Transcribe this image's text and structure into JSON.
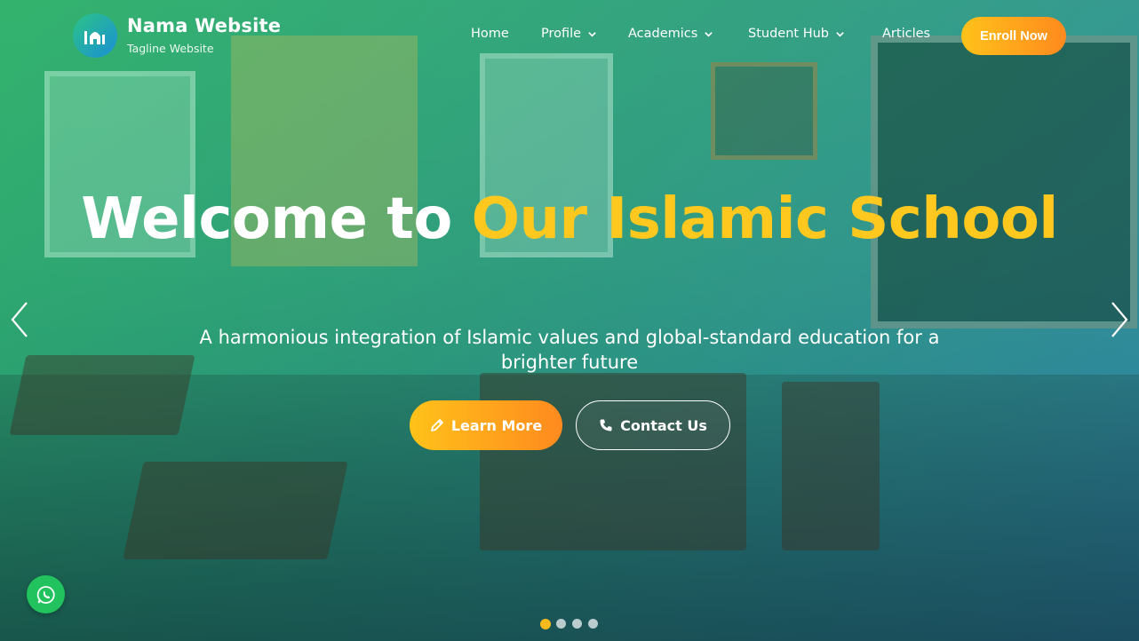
{
  "brand": {
    "name": "Nama Website",
    "tagline": "Tagline Website"
  },
  "nav": {
    "items": [
      {
        "label": "Home",
        "dropdown": false
      },
      {
        "label": "Profile",
        "dropdown": true
      },
      {
        "label": "Academics",
        "dropdown": true
      },
      {
        "label": "Student Hub",
        "dropdown": true
      },
      {
        "label": "Articles",
        "dropdown": false
      }
    ],
    "cta": "Enroll Now"
  },
  "hero": {
    "title_part1": "Welcome to ",
    "title_accent": "Our Islamic School",
    "subtitle": "A harmonious integration of Islamic values and global-standard education for a brighter future",
    "buttons": {
      "learn_more": "Learn More",
      "contact_us": "Contact Us"
    },
    "slides_total": 4,
    "active_slide": 1
  },
  "colors": {
    "accent": "#ffc81f",
    "cta_gradient_start": "#ffc21a",
    "cta_gradient_end": "#ff8a1e",
    "overlay_green": "#22be6e",
    "overlay_blue": "#288cbe",
    "whatsapp": "#22c35e"
  },
  "icons": {
    "logo": "mosque-icon",
    "learn_more": "pencil-icon",
    "contact_us": "phone-icon",
    "prev": "chevron-left-icon",
    "next": "chevron-right-icon",
    "floating": "whatsapp-icon"
  }
}
